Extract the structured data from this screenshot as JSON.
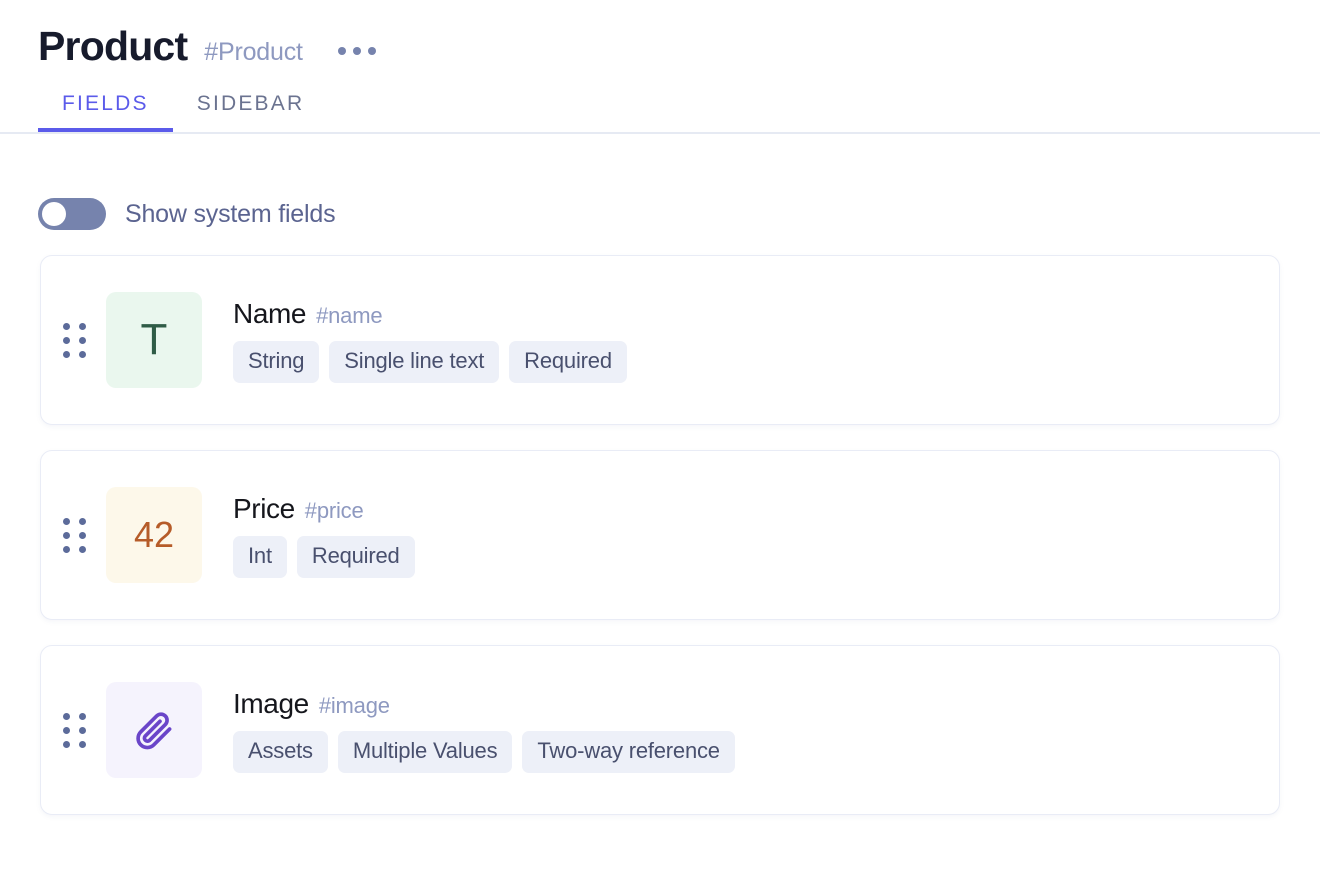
{
  "header": {
    "title": "Product",
    "slug": "#Product",
    "more_icon": "ellipsis-horizontal-icon"
  },
  "tabs": [
    {
      "label": "FIELDS",
      "active": true
    },
    {
      "label": "SIDEBAR",
      "active": false
    }
  ],
  "system_fields_toggle": {
    "label": "Show system fields",
    "checked": false
  },
  "colors": {
    "accent": "#5b5bea",
    "title": "#171b2c",
    "slug": "#8e99c0",
    "chip_bg": "#edf0f8",
    "chip_text": "#49506e",
    "handle": "#5c6b9a",
    "toggle_track": "#7683ad"
  },
  "fields": [
    {
      "name": "Name",
      "slug": "#name",
      "icon": "text-type-icon",
      "icon_glyph": "T",
      "icon_class": "glyph-t",
      "icon_bg": "#eaf7ee",
      "icon_fg": "#2f5c46",
      "chips": [
        "String",
        "Single line text",
        "Required"
      ]
    },
    {
      "name": "Price",
      "slug": "#price",
      "icon": "number-type-icon",
      "icon_glyph": "42",
      "icon_class": "glyph-42",
      "icon_bg": "#fdf8ea",
      "icon_fg": "#b65c29",
      "chips": [
        "Int",
        "Required"
      ]
    },
    {
      "name": "Image",
      "slug": "#image",
      "icon": "paperclip-icon",
      "icon_glyph": "",
      "icon_class": "glyph-clip",
      "icon_bg": "#f5f3fd",
      "icon_fg": "#6a45c9",
      "chips": [
        "Assets",
        "Multiple Values",
        "Two-way reference"
      ]
    }
  ]
}
